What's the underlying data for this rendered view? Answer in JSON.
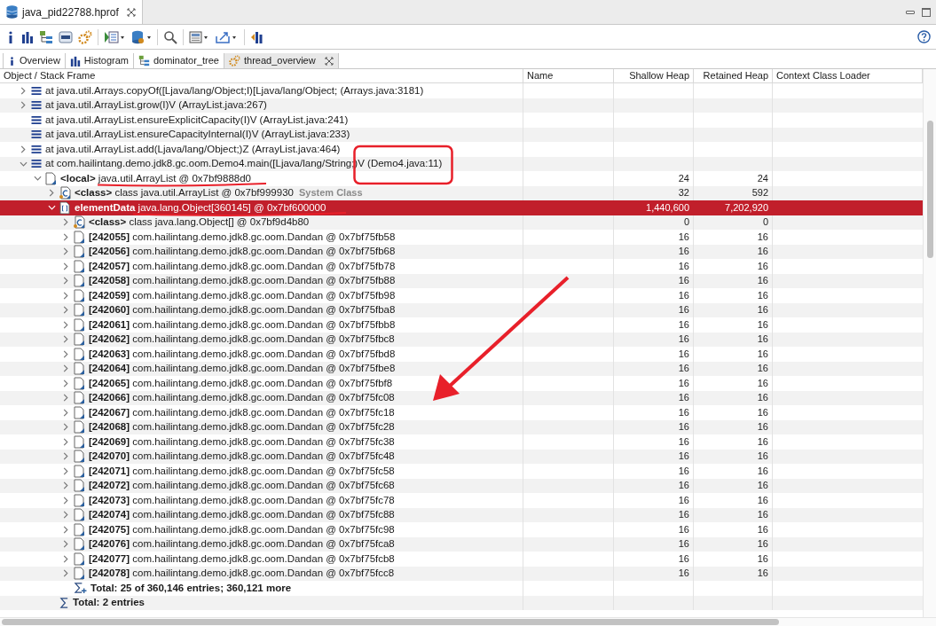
{
  "editor_tab": {
    "title": "java_pid22788.hprof",
    "selected": true
  },
  "tabs": [
    {
      "label": "Overview",
      "kind": "info",
      "selected": false
    },
    {
      "label": "Histogram",
      "kind": "histogram",
      "selected": false
    },
    {
      "label": "dominator_tree",
      "kind": "tree",
      "selected": false
    },
    {
      "label": "thread_overview",
      "kind": "gears",
      "selected": true
    }
  ],
  "table": {
    "columns": [
      "Object / Stack Frame",
      "Name",
      "Shallow Heap",
      "Retained Heap",
      "Context Class Loader"
    ],
    "rows": [
      {
        "kind": "frame",
        "label": "at java.util.Arrays.copyOf([Ljava/lang/Object;I)[Ljava/lang/Object; (Arrays.java:3181)",
        "expanded": false,
        "selected": false
      },
      {
        "kind": "frame",
        "label": "at java.util.ArrayList.grow(I)V (ArrayList.java:267)",
        "expanded": false,
        "selected": false
      },
      {
        "kind": "frame",
        "label": "at java.util.ArrayList.ensureExplicitCapacity(I)V (ArrayList.java:241)",
        "selected": false
      },
      {
        "kind": "frame",
        "label": "at java.util.ArrayList.ensureCapacityInternal(I)V (ArrayList.java:233)",
        "selected": false
      },
      {
        "kind": "frame",
        "label": "at java.util.ArrayList.add(Ljava/lang/Object;)Z (ArrayList.java:464)",
        "expanded": false,
        "selected": false
      },
      {
        "kind": "frame",
        "label": "at com.hailintang.demo.jdk8.gc.oom.Demo4.main([Ljava/lang/String;)V (Demo4.java:11)",
        "expanded": true,
        "selected": false,
        "children": [
          {
            "kind": "object",
            "label": "**<local>** java.util.ArrayList @ 0x7bf9888d0",
            "shallow_heap": "24",
            "retained_heap": "24",
            "expanded": true,
            "selected": false,
            "children": [
              {
                "kind": "class",
                "label": "**<class>** class java.util.ArrayList @ 0x7bf999930",
                "note": "System Class",
                "shallow_heap": "32",
                "retained_heap": "592",
                "expanded": false,
                "selected": false
              },
              {
                "kind": "array",
                "label": "**elementData** java.lang.Object[360145] @ 0x7bf600000",
                "shallow_heap": "1,440,600",
                "retained_heap": "7,202,920",
                "expanded": true,
                "selected": true,
                "children": [
                  {
                    "kind": "class",
                    "label": "**<class>** class java.lang.Object[] @ 0x7bf9d4b80",
                    "shallow_heap": "0",
                    "retained_heap": "0",
                    "expanded": false,
                    "selected": false
                  },
                  {
                    "kind": "object",
                    "label": "**[242055]** com.hailintang.demo.jdk8.gc.oom.Dandan @ 0x7bf75fb58",
                    "shallow_heap": "16",
                    "retained_heap": "16",
                    "expanded": false,
                    "selected": false
                  },
                  {
                    "kind": "object",
                    "label": "**[242056]** com.hailintang.demo.jdk8.gc.oom.Dandan @ 0x7bf75fb68",
                    "shallow_heap": "16",
                    "retained_heap": "16",
                    "expanded": false,
                    "selected": false
                  },
                  {
                    "kind": "object",
                    "label": "**[242057]** com.hailintang.demo.jdk8.gc.oom.Dandan @ 0x7bf75fb78",
                    "shallow_heap": "16",
                    "retained_heap": "16",
                    "expanded": false,
                    "selected": false
                  },
                  {
                    "kind": "object",
                    "label": "**[242058]** com.hailintang.demo.jdk8.gc.oom.Dandan @ 0x7bf75fb88",
                    "shallow_heap": "16",
                    "retained_heap": "16",
                    "expanded": false,
                    "selected": false
                  },
                  {
                    "kind": "object",
                    "label": "**[242059]** com.hailintang.demo.jdk8.gc.oom.Dandan @ 0x7bf75fb98",
                    "shallow_heap": "16",
                    "retained_heap": "16",
                    "expanded": false,
                    "selected": false
                  },
                  {
                    "kind": "object",
                    "label": "**[242060]** com.hailintang.demo.jdk8.gc.oom.Dandan @ 0x7bf75fba8",
                    "shallow_heap": "16",
                    "retained_heap": "16",
                    "expanded": false,
                    "selected": false
                  },
                  {
                    "kind": "object",
                    "label": "**[242061]** com.hailintang.demo.jdk8.gc.oom.Dandan @ 0x7bf75fbb8",
                    "shallow_heap": "16",
                    "retained_heap": "16",
                    "expanded": false,
                    "selected": false
                  },
                  {
                    "kind": "object",
                    "label": "**[242062]** com.hailintang.demo.jdk8.gc.oom.Dandan @ 0x7bf75fbc8",
                    "shallow_heap": "16",
                    "retained_heap": "16",
                    "expanded": false,
                    "selected": false
                  },
                  {
                    "kind": "object",
                    "label": "**[242063]** com.hailintang.demo.jdk8.gc.oom.Dandan @ 0x7bf75fbd8",
                    "shallow_heap": "16",
                    "retained_heap": "16",
                    "expanded": false,
                    "selected": false
                  },
                  {
                    "kind": "object",
                    "label": "**[242064]** com.hailintang.demo.jdk8.gc.oom.Dandan @ 0x7bf75fbe8",
                    "shallow_heap": "16",
                    "retained_heap": "16",
                    "expanded": false,
                    "selected": false
                  },
                  {
                    "kind": "object",
                    "label": "**[242065]** com.hailintang.demo.jdk8.gc.oom.Dandan @ 0x7bf75fbf8",
                    "shallow_heap": "16",
                    "retained_heap": "16",
                    "expanded": false,
                    "selected": false
                  },
                  {
                    "kind": "object",
                    "label": "**[242066]** com.hailintang.demo.jdk8.gc.oom.Dandan @ 0x7bf75fc08",
                    "shallow_heap": "16",
                    "retained_heap": "16",
                    "expanded": false,
                    "selected": false
                  },
                  {
                    "kind": "object",
                    "label": "**[242067]** com.hailintang.demo.jdk8.gc.oom.Dandan @ 0x7bf75fc18",
                    "shallow_heap": "16",
                    "retained_heap": "16",
                    "expanded": false,
                    "selected": false
                  },
                  {
                    "kind": "object",
                    "label": "**[242068]** com.hailintang.demo.jdk8.gc.oom.Dandan @ 0x7bf75fc28",
                    "shallow_heap": "16",
                    "retained_heap": "16",
                    "expanded": false,
                    "selected": false
                  },
                  {
                    "kind": "object",
                    "label": "**[242069]** com.hailintang.demo.jdk8.gc.oom.Dandan @ 0x7bf75fc38",
                    "shallow_heap": "16",
                    "retained_heap": "16",
                    "expanded": false,
                    "selected": false
                  },
                  {
                    "kind": "object",
                    "label": "**[242070]** com.hailintang.demo.jdk8.gc.oom.Dandan @ 0x7bf75fc48",
                    "shallow_heap": "16",
                    "retained_heap": "16",
                    "expanded": false,
                    "selected": false
                  },
                  {
                    "kind": "object",
                    "label": "**[242071]** com.hailintang.demo.jdk8.gc.oom.Dandan @ 0x7bf75fc58",
                    "shallow_heap": "16",
                    "retained_heap": "16",
                    "expanded": false,
                    "selected": false
                  },
                  {
                    "kind": "object",
                    "label": "**[242072]** com.hailintang.demo.jdk8.gc.oom.Dandan @ 0x7bf75fc68",
                    "shallow_heap": "16",
                    "retained_heap": "16",
                    "expanded": false,
                    "selected": false
                  },
                  {
                    "kind": "object",
                    "label": "**[242073]** com.hailintang.demo.jdk8.gc.oom.Dandan @ 0x7bf75fc78",
                    "shallow_heap": "16",
                    "retained_heap": "16",
                    "expanded": false,
                    "selected": false
                  },
                  {
                    "kind": "object",
                    "label": "**[242074]** com.hailintang.demo.jdk8.gc.oom.Dandan @ 0x7bf75fc88",
                    "shallow_heap": "16",
                    "retained_heap": "16",
                    "expanded": false,
                    "selected": false
                  },
                  {
                    "kind": "object",
                    "label": "**[242075]** com.hailintang.demo.jdk8.gc.oom.Dandan @ 0x7bf75fc98",
                    "shallow_heap": "16",
                    "retained_heap": "16",
                    "expanded": false,
                    "selected": false
                  },
                  {
                    "kind": "object",
                    "label": "**[242076]** com.hailintang.demo.jdk8.gc.oom.Dandan @ 0x7bf75fca8",
                    "shallow_heap": "16",
                    "retained_heap": "16",
                    "expanded": false,
                    "selected": false
                  },
                  {
                    "kind": "object",
                    "label": "**[242077]** com.hailintang.demo.jdk8.gc.oom.Dandan @ 0x7bf75fcb8",
                    "shallow_heap": "16",
                    "retained_heap": "16",
                    "expanded": false,
                    "selected": false
                  },
                  {
                    "kind": "object",
                    "label": "**[242078]** com.hailintang.demo.jdk8.gc.oom.Dandan @ 0x7bf75fcc8",
                    "shallow_heap": "16",
                    "retained_heap": "16",
                    "expanded": false,
                    "selected": false
                  },
                  {
                    "kind": "total_more",
                    "label": "Total: 25 of 360,146 entries; 360,121 more",
                    "selected": false
                  }
                ]
              },
              {
                "kind": "total",
                "label": "Total: 2 entries",
                "selected": false
              }
            ]
          }
        ]
      }
    ]
  }
}
